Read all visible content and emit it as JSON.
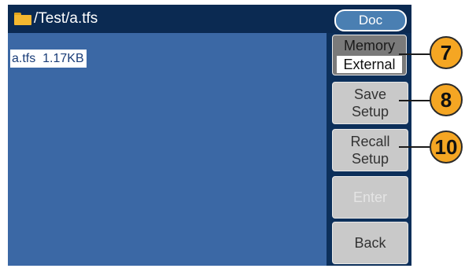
{
  "titlebar": {
    "path": "/Test/a.tfs",
    "folder_icon": "folder-icon",
    "doc_label": "Doc"
  },
  "file_list": {
    "items": [
      {
        "name": "a.tfs",
        "size": "1.17KB",
        "display": "a.tfs  1.17KB"
      }
    ]
  },
  "softkeys": {
    "memory": {
      "label": "Memory",
      "value": "External"
    },
    "save": {
      "line1": "Save",
      "line2": "Setup"
    },
    "recall": {
      "line1": "Recall",
      "line2": "Setup"
    },
    "enter": {
      "label": "Enter",
      "enabled": false
    },
    "back": {
      "label": "Back"
    }
  },
  "callouts": [
    "7",
    "8",
    "10"
  ],
  "colors": {
    "screen_bg": "#0c2f5a",
    "list_bg": "#3b68a5",
    "softkey_bg": "#c9c9c9",
    "callout_bg": "#f5a623",
    "folder": "#f4b830"
  }
}
